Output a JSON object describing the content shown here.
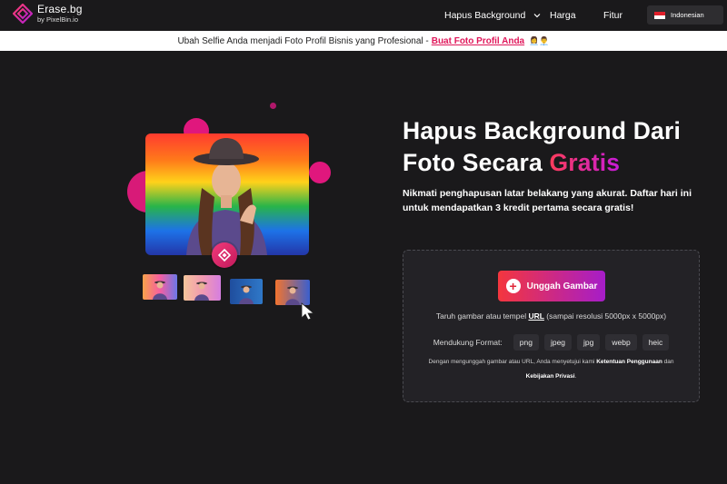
{
  "header": {
    "brand_title": "Erase.bg",
    "brand_sub": "by PixelBin.io",
    "nav": [
      {
        "label": "Hapus Background"
      },
      {
        "label": "Harga"
      },
      {
        "label": "Fitur"
      }
    ],
    "language": "Indonesian"
  },
  "announcement": {
    "text": "Ubah Selfie Anda menjadi Foto Profil Bisnis yang Profesional - ",
    "link": "Buat Foto Profil Anda",
    "icons": "👩‍💼👨‍💼"
  },
  "hero": {
    "headline_line1": "Hapus Background Dari",
    "headline_line2": "Foto Secara ",
    "headline_accent": "Gratis",
    "subtitle": "Nikmati penghapusan latar belakang yang akurat. Daftar hari ini untuk mendapatkan 3 kredit pertama secara gratis!"
  },
  "upload": {
    "button_label": "Unggah Gambar",
    "drop_prefix": "Taruh gambar atau tempel ",
    "drop_url": "URL",
    "drop_suffix": " (sampai resolusi 5000px x 5000px)",
    "formats_label": "Mendukung Format:",
    "formats": [
      "png",
      "jpeg",
      "jpg",
      "webp",
      "heic"
    ],
    "terms_prefix": "Dengan mengunggah gambar atau URL, Anda menyetujui kami ",
    "terms_link1": "Ketentuan Penggunaan",
    "terms_mid": " dan ",
    "terms_link2": "Kebijakan Privasi",
    "terms_end": "."
  },
  "colors": {
    "background": "#1a191b",
    "accent_red": "#f4363e",
    "accent_purple": "#a61dc9",
    "link_pink": "#e0175a"
  }
}
